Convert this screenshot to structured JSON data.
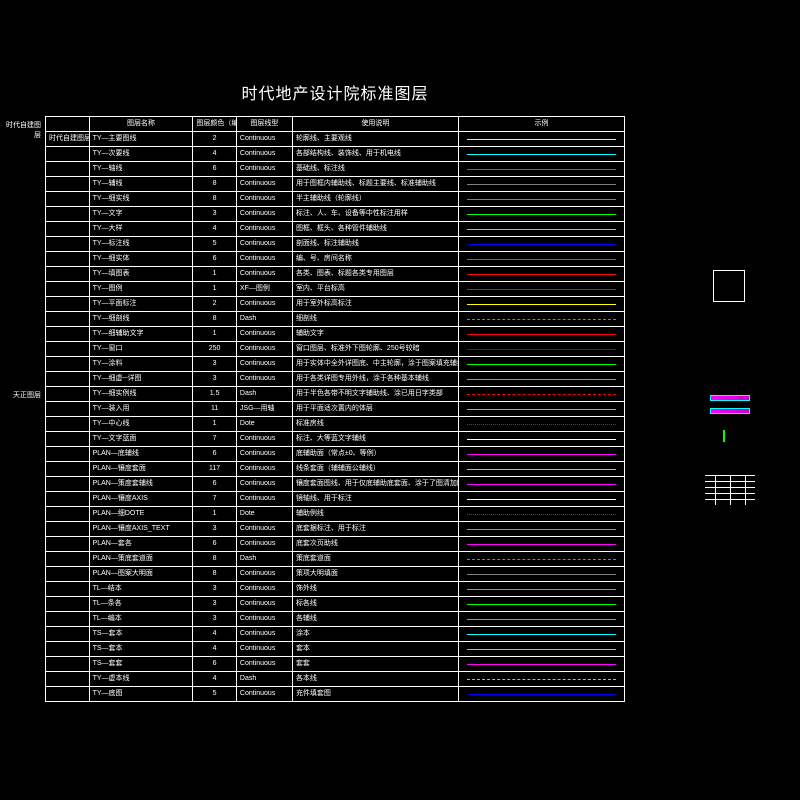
{
  "title": "时代地产设计院标准图层",
  "headers": {
    "group": "",
    "name": "图层名称",
    "color": "图层颜色（编号）",
    "ltype": "图层线型",
    "desc": "使用说明",
    "sample": "示例"
  },
  "side_labels": {
    "group1": "时代自建图层",
    "group2": "天正图层"
  },
  "rows": [
    {
      "group": "时代自建图层",
      "name": "TY—主要图线",
      "color": "2",
      "ltype": "Continuous",
      "desc": "轮廓线、主要观线",
      "sample": "#ffff00"
    },
    {
      "name": "TY—次要线",
      "color": "4",
      "ltype": "Continuous",
      "desc": "各部结构线、装饰线、用于机电线",
      "sample": "#00ffff"
    },
    {
      "name": "TY—轴线",
      "color": "6",
      "ltype": "Continuous",
      "desc": "基础线、标注线",
      "sample": "#ff00ff"
    },
    {
      "name": "TY—辅线",
      "color": "8",
      "ltype": "Continuous",
      "desc": "用于图框内辅助线、标题主要线、标准辅助线",
      "sample": "#808080"
    },
    {
      "name": "TY—细实线",
      "color": "8",
      "ltype": "Continuous",
      "desc": "半主辅助线（轮廓线）",
      "sample": "#808080"
    },
    {
      "name": "TY—文字",
      "color": "3",
      "ltype": "Continuous",
      "desc": "标注、人、车、设备等中性标注用样",
      "sample": "#00ff00"
    },
    {
      "name": "TY—大样",
      "color": "4",
      "ltype": "Continuous",
      "desc": "图框、框头、各种管件辅助线",
      "sample": "#00ffff"
    },
    {
      "name": "TY—标注线",
      "color": "5",
      "ltype": "Continuous",
      "desc": "剖面线、标注辅助线",
      "sample": "#0000ff"
    },
    {
      "name": "TY—细实体",
      "color": "6",
      "ltype": "Continuous",
      "desc": "编、号、房间名称",
      "sample": "#ff00ff"
    },
    {
      "name": "TY—填图表",
      "color": "1",
      "ltype": "Continuous",
      "desc": "各类、图表、标题各类专用图层",
      "sample": "#ff0000"
    },
    {
      "name": "TY—图例",
      "color": "1",
      "ltype": "XF—图例",
      "desc": "室内、平台标高",
      "sample": "#ff0000"
    },
    {
      "name": "TY—平面标注",
      "color": "2",
      "ltype": "Continuous",
      "desc": "用于室外标高标注",
      "sample": "#ffff00"
    },
    {
      "name": "TY—细剖线",
      "color": "8",
      "ltype": "Dash",
      "desc": "细剖线",
      "sample": "#808080",
      "dash": true
    },
    {
      "name": "TY—细辅助文字",
      "color": "1",
      "ltype": "Continuous",
      "desc": "辅助文字",
      "sample": "#ff0000"
    },
    {
      "name": "TY—窗口",
      "color": "250",
      "ltype": "Continuous",
      "desc": "窗口图层、标准外下图轮廓、250号较暗",
      "sample": "#333333"
    },
    {
      "name": "TY—涂料",
      "color": "3",
      "ltype": "Continuous",
      "desc": "用于实体中全外详图底、中主轮廓，涂于图案填充辅线",
      "sample": "#00ff00"
    },
    {
      "name": "TY—细虚─详图",
      "color": "3",
      "ltype": "Continuous",
      "desc": "用于各类详图专用外线，涂于各种基本辅线",
      "sample": "#00ff00"
    },
    {
      "name": "TY—细实例线",
      "color": "1.5",
      "ltype": "Dash",
      "desc": "用于半色各带不明文字辅助线、涂已用日字类部",
      "sample": "#ff0000",
      "dash": true
    },
    {
      "name": "TY—装入用",
      "color": "11",
      "ltype": "JSG—用轴",
      "desc": "用于平面适次置内的体层",
      "sample": "#ff8080"
    },
    {
      "name": "TY—中心线",
      "color": "1",
      "ltype": "Dote",
      "desc": "标准房线",
      "sample": "#ff0000",
      "dot": true
    },
    {
      "name": "TY—文字蓝面",
      "color": "7",
      "ltype": "Continuous",
      "desc": "标注、大等蓝文字辅线",
      "sample": "#ffffff"
    },
    {
      "name": "PLAN—底辅线",
      "color": "6",
      "ltype": "Continuous",
      "desc": "底辅助面（常点±0、等例）",
      "sample": "#ff00ff"
    },
    {
      "name": "PLAN—镶度套面",
      "color": "117",
      "ltype": "Continuous",
      "desc": "线条套面（辅辅面公辅线）",
      "sample": "#80ff00"
    },
    {
      "name": "PLAN—策度套辅线",
      "color": "6",
      "ltype": "Continuous",
      "desc": "镶度套面图线、用于仅底辅助底套面、涂于了图清加图社",
      "sample": "#ff00ff"
    },
    {
      "name": "PLAN—镶度AXIS",
      "color": "7",
      "ltype": "Continuous",
      "desc": "镜轴线、用于标注",
      "sample": "#ffffff"
    },
    {
      "name": "PLAN—细DOTE",
      "color": "1",
      "ltype": "Dote",
      "desc": "辅助例线",
      "sample": "#ff0000",
      "dot": true
    },
    {
      "name": "PLAN—镶度AXIS_TEXT",
      "color": "3",
      "ltype": "Continuous",
      "desc": "底套据标注、用于标注",
      "sample": "#00ff00"
    },
    {
      "name": "PLAN—套各",
      "color": "6",
      "ltype": "Continuous",
      "desc": "底套次页助线",
      "sample": "#ff00ff"
    },
    {
      "name": "PLAN—策底套道面",
      "color": "8",
      "ltype": "Dash",
      "desc": "策底套道面",
      "sample": "#808080",
      "dash": true
    },
    {
      "name": "PLAN—图案大明面",
      "color": "8",
      "ltype": "Continuous",
      "desc": "策项大明填面",
      "sample": "#808080"
    },
    {
      "name": "TL—结本",
      "color": "3",
      "ltype": "Continuous",
      "desc": "饰外线",
      "sample": "#00ff00"
    },
    {
      "name": "TL—条各",
      "color": "3",
      "ltype": "Continuous",
      "desc": "标各线",
      "sample": "#00ff00"
    },
    {
      "name": "TL—编本",
      "color": "3",
      "ltype": "Continuous",
      "desc": "各辅线",
      "sample": "#00ff00"
    },
    {
      "name": "TS—套本",
      "color": "4",
      "ltype": "Continuous",
      "desc": "涂本",
      "sample": "#00ffff"
    },
    {
      "name": "TS—套本",
      "color": "4",
      "ltype": "Continuous",
      "desc": "套本",
      "sample": "#00ffff"
    },
    {
      "name": "TS—套套",
      "color": "6",
      "ltype": "Continuous",
      "desc": "套套",
      "sample": "#ff00ff"
    },
    {
      "name": "TY—虚本线",
      "color": "4",
      "ltype": "Dash",
      "desc": "各本线",
      "sample": "#00ffff",
      "dash": true
    },
    {
      "name": "TY—底图",
      "color": "5",
      "ltype": "Continuous",
      "desc": "充件填套图",
      "sample": "#0000ff"
    }
  ]
}
